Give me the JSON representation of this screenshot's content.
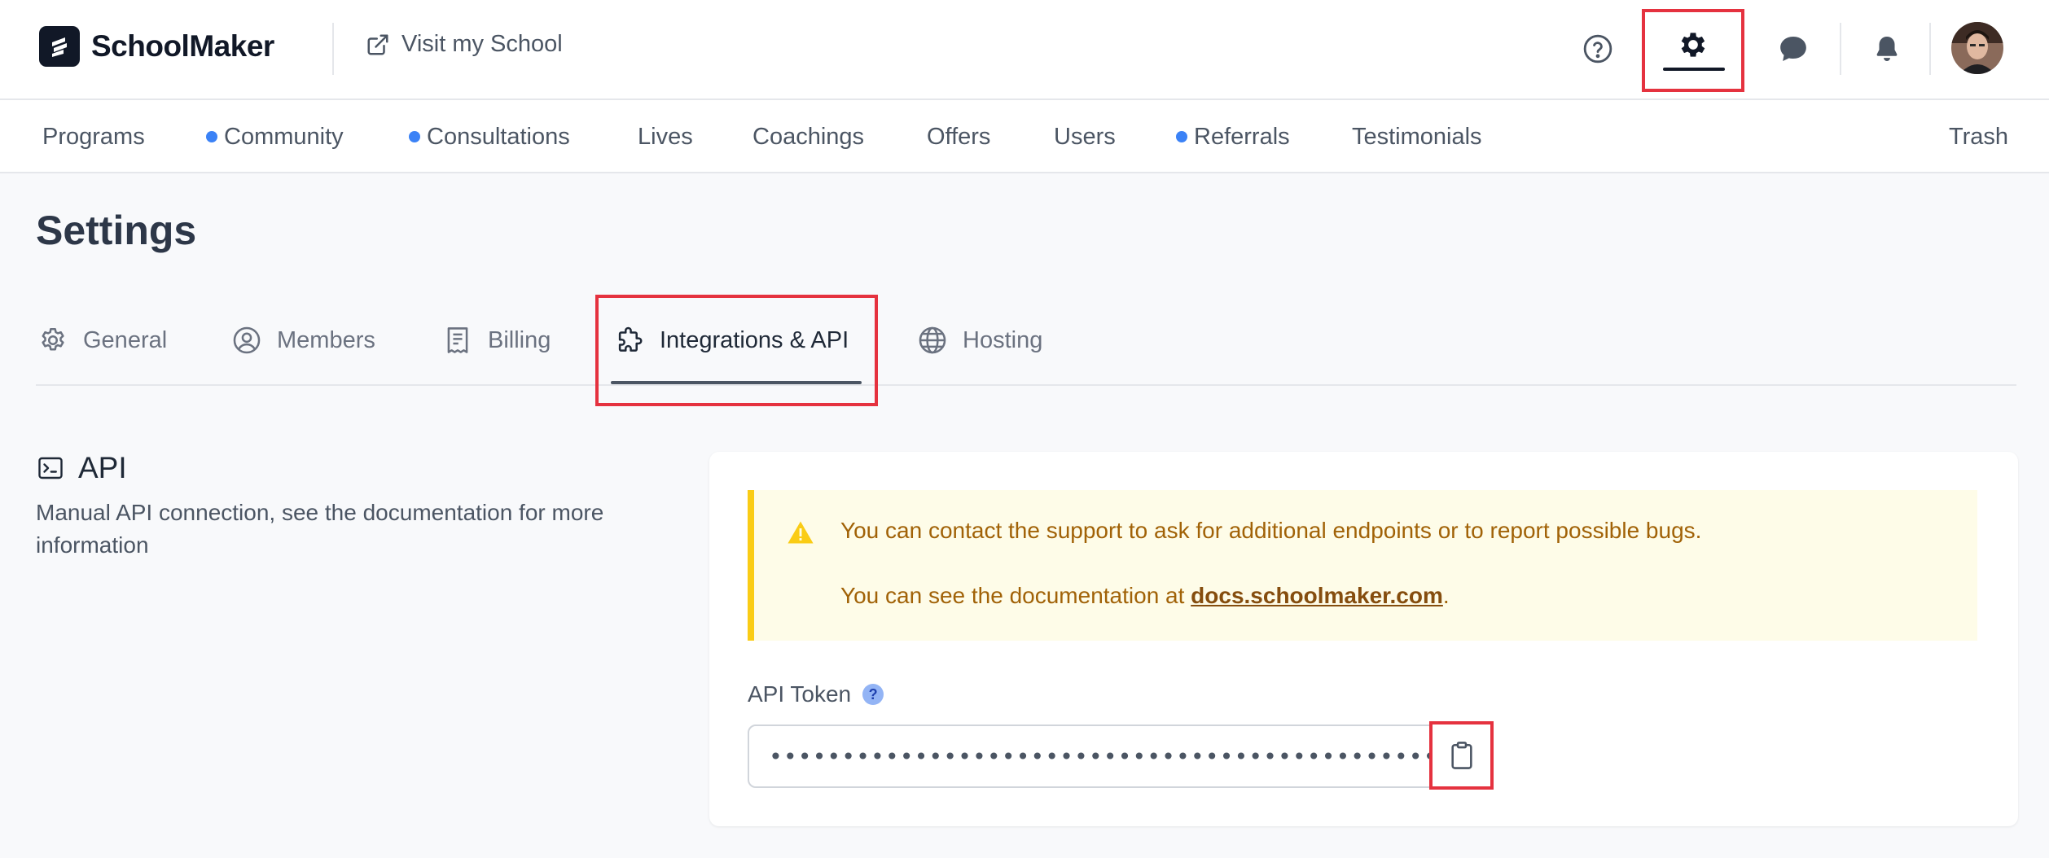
{
  "header": {
    "brand": "SchoolMaker",
    "visit_label": "Visit my School"
  },
  "nav": {
    "items": [
      {
        "label": "Programs",
        "dot": false
      },
      {
        "label": "Community",
        "dot": true
      },
      {
        "label": "Consultations",
        "dot": true
      },
      {
        "label": "Lives",
        "dot": false
      },
      {
        "label": "Coachings",
        "dot": false
      },
      {
        "label": "Offers",
        "dot": false
      },
      {
        "label": "Users",
        "dot": false
      },
      {
        "label": "Referrals",
        "dot": true
      },
      {
        "label": "Testimonials",
        "dot": false
      }
    ],
    "trash_label": "Trash"
  },
  "page": {
    "title": "Settings",
    "tabs": [
      {
        "label": "General",
        "icon": "gear-outline-icon"
      },
      {
        "label": "Members",
        "icon": "user-circle-icon"
      },
      {
        "label": "Billing",
        "icon": "receipt-icon"
      },
      {
        "label": "Integrations & API",
        "icon": "puzzle-icon",
        "active": true
      },
      {
        "label": "Hosting",
        "icon": "globe-icon"
      }
    ]
  },
  "api": {
    "title": "API",
    "description": "Manual API connection, see the documentation for more information",
    "alert": {
      "line1": "You can contact the support to ask for additional endpoints or to report possible bugs.",
      "line2_prefix": "You can see the documentation at ",
      "link": "docs.schoolmaker.com",
      "line2_suffix": "."
    },
    "token_label": "API Token",
    "token_help": "?",
    "token_value": "•••••••••••••••••••••••••••••••••••••••••••••••••"
  },
  "colors": {
    "accent_dot": "#3b82f6",
    "highlight": "#e5323f",
    "alert_bg": "#fefce8",
    "alert_border": "#facc15",
    "alert_text": "#a16207"
  }
}
